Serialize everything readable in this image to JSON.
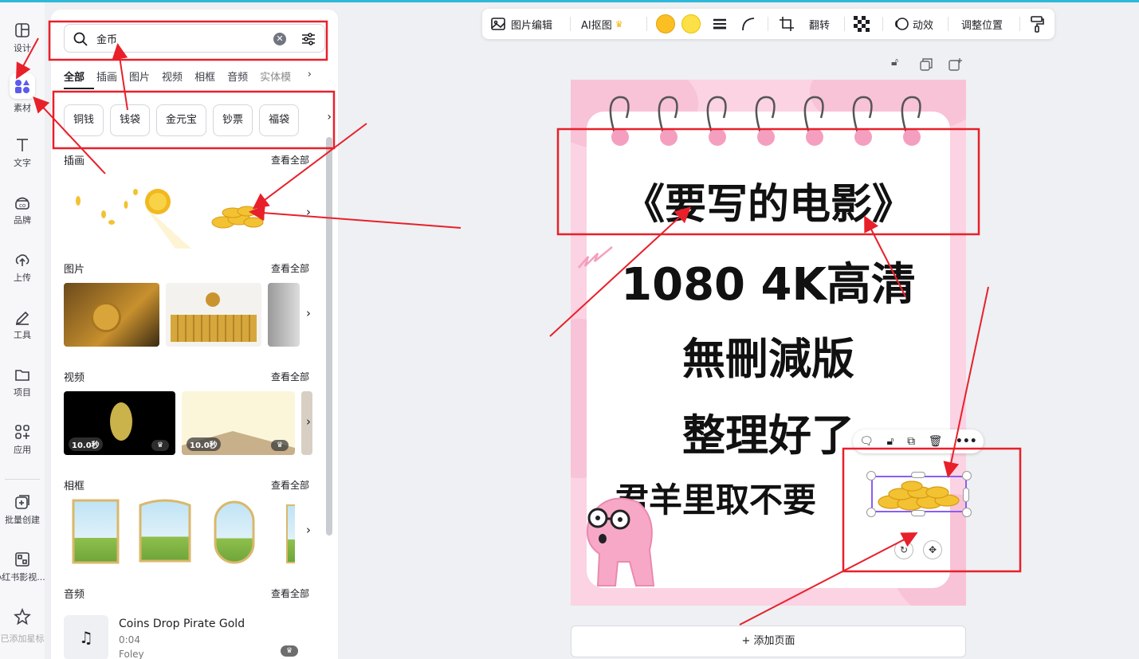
{
  "sidebar": {
    "items": [
      {
        "label": "设计",
        "icon": "layout-icon"
      },
      {
        "label": "素材",
        "icon": "elements-icon"
      },
      {
        "label": "文字",
        "icon": "text-icon"
      },
      {
        "label": "品牌",
        "icon": "brand-icon"
      },
      {
        "label": "上传",
        "icon": "upload-icon"
      },
      {
        "label": "工具",
        "icon": "pen-icon"
      },
      {
        "label": "项目",
        "icon": "folder-icon"
      },
      {
        "label": "应用",
        "icon": "apps-icon"
      },
      {
        "label": "批量创建",
        "icon": "bulk-create-icon"
      },
      {
        "label": "小红书影视...",
        "icon": "qr-app-icon"
      },
      {
        "label": "已添加星标",
        "icon": "star-icon"
      }
    ]
  },
  "search": {
    "query": "金币"
  },
  "tabs": [
    "全部",
    "插画",
    "图片",
    "视频",
    "相框",
    "音频",
    "实体模"
  ],
  "chips": [
    "铜钱",
    "钱袋",
    "金元宝",
    "钞票",
    "福袋"
  ],
  "sections": {
    "illustrations": {
      "title": "插画",
      "see_all": "查看全部"
    },
    "photos": {
      "title": "图片",
      "see_all": "查看全部"
    },
    "videos": {
      "title": "视频",
      "see_all": "查看全部",
      "durations": [
        "10.0秒",
        "10.0秒"
      ]
    },
    "frames": {
      "title": "相框",
      "see_all": "查看全部"
    },
    "audio": {
      "title": "音频",
      "see_all": "查看全部",
      "track": {
        "title": "Coins Drop Pirate Gold",
        "duration": "0:04",
        "category": "Foley"
      }
    }
  },
  "toolbar": {
    "image_edit": "图片编辑",
    "ai_cutout": "AI抠图",
    "flip": "翻转",
    "animate": "动效",
    "position": "调整位置",
    "colors": [
      "#fbbf24",
      "#fde047"
    ]
  },
  "canvas": {
    "line1": "《要写的电影》",
    "line2": "1080 4K高清",
    "line3": "無刪減版",
    "line4": "整理好了",
    "line5": "君羊里取不要"
  },
  "add_page": "+ 添加页面",
  "colors": {
    "accent_red": "#e8202a",
    "selection": "#8b5cf6",
    "page_pink": "#fbd3e3",
    "ring_pink": "#f59fc0"
  }
}
